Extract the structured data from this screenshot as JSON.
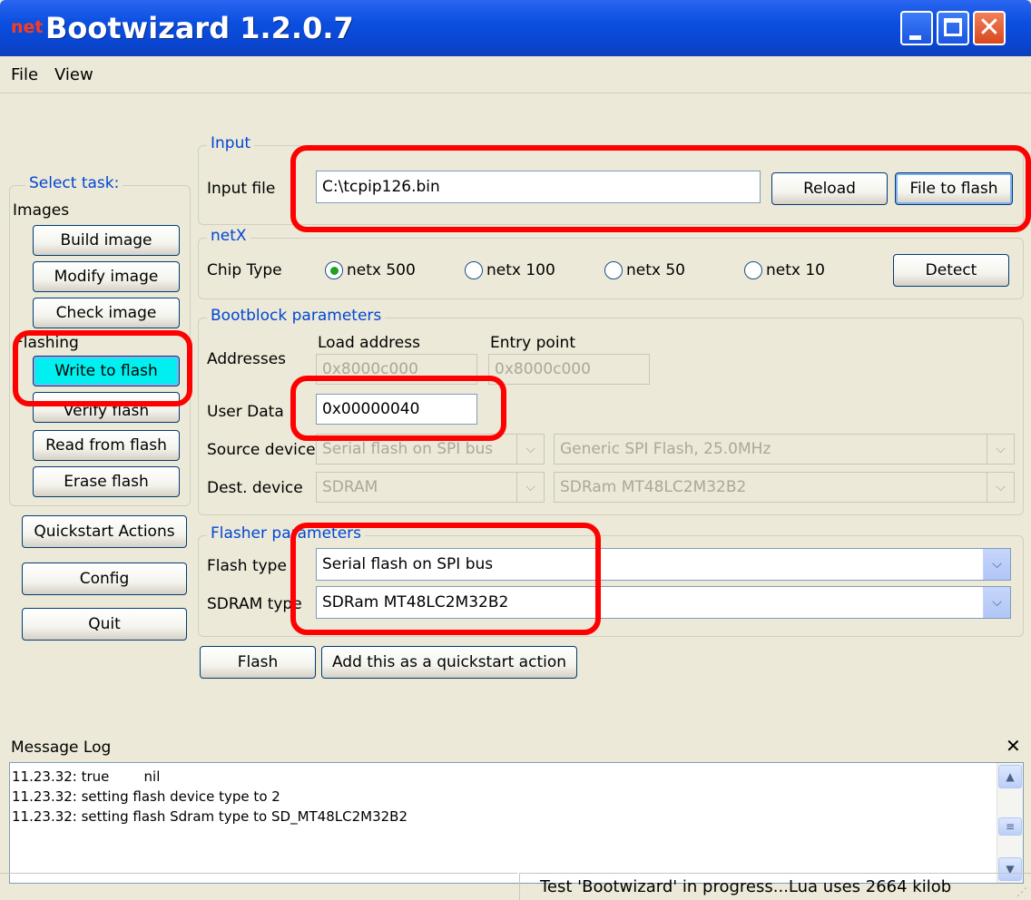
{
  "window": {
    "title": "Bootwizard 1.2.0.7",
    "icon_text": "net"
  },
  "menu": {
    "file": "File",
    "view": "View"
  },
  "sidebar": {
    "group_title": "Select task:",
    "images_label": "Images",
    "build_image": "Build image",
    "modify_image": "Modify image",
    "check_image": "Check image",
    "flashing_label": "Flashing",
    "write_to_flash": "Write to flash",
    "verify_flash": "Verify flash",
    "read_from_flash": "Read from flash",
    "erase_flash": "Erase flash",
    "quickstart_actions": "Quickstart Actions",
    "config": "Config",
    "quit": "Quit"
  },
  "input_group": {
    "title": "Input",
    "file_label": "Input file",
    "file_value": "C:\\tcpip126.bin",
    "reload": "Reload",
    "file_to_flash": "File to flash"
  },
  "netx_group": {
    "title": "netX",
    "chip_type_label": "Chip Type",
    "options": [
      "netx 500",
      "netx 100",
      "netx 50",
      "netx 10"
    ],
    "selected": "netx 500",
    "detect": "Detect"
  },
  "bootblock_group": {
    "title": "Bootblock parameters",
    "addresses_label": "Addresses",
    "load_address_label": "Load address",
    "entry_point_label": "Entry point",
    "load_address_value": "0x8000c000",
    "entry_point_value": "0x8000c000",
    "user_data_label": "User Data",
    "user_data_value": "0x00000040",
    "source_device_label": "Source device",
    "source_device_value": "Serial flash on SPI bus",
    "source_device_detail": "Generic SPI Flash, 25.0MHz",
    "dest_device_label": "Dest. device",
    "dest_device_value": "SDRAM",
    "dest_device_detail": "SDRam MT48LC2M32B2"
  },
  "flasher_group": {
    "title": "Flasher parameters",
    "flash_type_label": "Flash type",
    "flash_type_value": "Serial flash on SPI bus",
    "sdram_type_label": "SDRAM type",
    "sdram_type_value": "SDRam MT48LC2M32B2"
  },
  "actions": {
    "flash": "Flash",
    "add_quickstart": "Add this as a quickstart action"
  },
  "message_log": {
    "title": "Message Log",
    "close": "✕",
    "lines": [
      "11.23.32: true        nil",
      "11.23.32: setting flash device type to 2",
      "11.23.32: setting flash Sdram type to SD_MT48LC2M32B2"
    ]
  },
  "status": {
    "text": "Test 'Bootwizard' in progress...Lua uses 2664 kilob"
  },
  "colors": {
    "accent": "#0046d5",
    "highlight": "#ff0000",
    "active_button": "#00f0f0",
    "titlebar": "#0b4fe0"
  }
}
